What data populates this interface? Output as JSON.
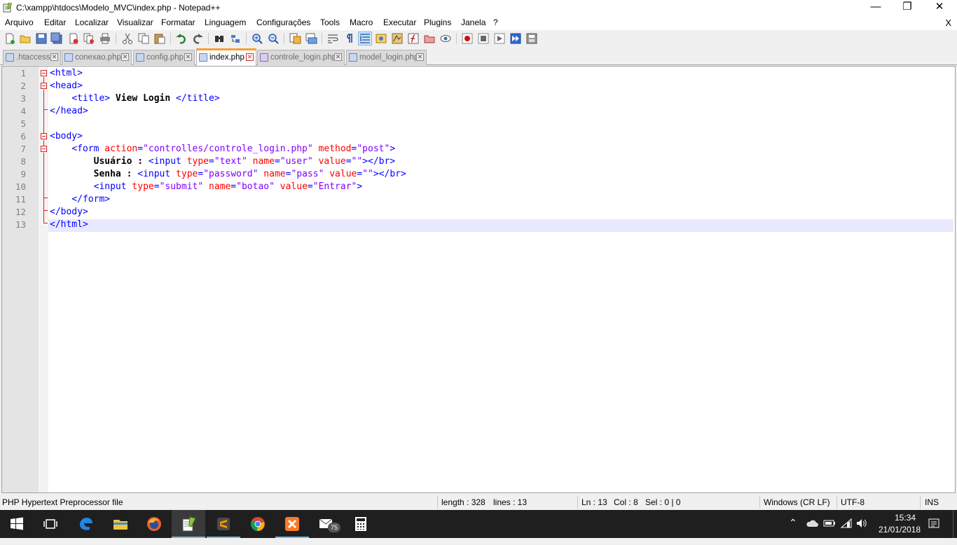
{
  "window": {
    "title": "C:\\xampp\\htdocs\\Modelo_MVC\\index.php - Notepad++",
    "minimize_glyph": "—",
    "restore_glyph": "❐",
    "close_glyph": "✕"
  },
  "menubar": {
    "items": [
      "Arquivo",
      "Editar",
      "Localizar",
      "Visualizar",
      "Formatar",
      "Linguagem",
      "Configurações",
      "Tools",
      "Macro",
      "Executar",
      "Plugins",
      "Janela",
      "?"
    ],
    "close_glyph": "X"
  },
  "toolbar": {
    "icons": [
      "new-file-icon",
      "open-file-icon",
      "save-icon",
      "save-all-icon",
      "close-file-icon",
      "close-all-icon",
      "print-icon",
      "cut-icon",
      "copy-icon",
      "paste-icon",
      "undo-icon",
      "redo-icon",
      "find-icon",
      "replace-icon",
      "zoom-in-icon",
      "zoom-out-icon",
      "sync-vertical-icon",
      "sync-horizontal-icon",
      "word-wrap-icon",
      "show-all-chars-icon",
      "indent-guide-icon",
      "user-defined-language-icon",
      "document-map-icon",
      "function-list-icon",
      "folder-workspace-icon",
      "monitoring-icon",
      "record-macro-icon",
      "stop-macro-icon",
      "play-macro-icon",
      "run-macro-multiple-icon",
      "save-macro-icon"
    ]
  },
  "tabs": [
    {
      "label": ".htaccess",
      "active": false,
      "icon": "file-icon"
    },
    {
      "label": "conexao.php",
      "active": false,
      "icon": "file-icon"
    },
    {
      "label": "config.php",
      "active": false,
      "icon": "file-icon"
    },
    {
      "label": "index.php",
      "active": true,
      "icon": "file-icon"
    },
    {
      "label": "controle_login.php",
      "active": false,
      "icon": "php-file-icon"
    },
    {
      "label": "model_login.php",
      "active": false,
      "icon": "file-icon"
    }
  ],
  "editor": {
    "line_numbers": [
      "1",
      "2",
      "3",
      "4",
      "5",
      "6",
      "7",
      "8",
      "9",
      "10",
      "11",
      "12",
      "13"
    ],
    "lines": [
      [
        {
          "c": "t",
          "s": "<html>"
        }
      ],
      [
        {
          "c": "t",
          "s": "<head>"
        }
      ],
      [
        {
          "c": "",
          "s": "    "
        },
        {
          "c": "t",
          "s": "<title>"
        },
        {
          "c": "x",
          "s": " View Login "
        },
        {
          "c": "t",
          "s": "</title>"
        }
      ],
      [
        {
          "c": "t",
          "s": "</head>"
        }
      ],
      [],
      [
        {
          "c": "t",
          "s": "<body>"
        }
      ],
      [
        {
          "c": "",
          "s": "    "
        },
        {
          "c": "t",
          "s": "<form "
        },
        {
          "c": "a",
          "s": "action"
        },
        {
          "c": "t",
          "s": "="
        },
        {
          "c": "v",
          "s": "\"controlles/controle_login.php\""
        },
        {
          "c": "t",
          "s": " "
        },
        {
          "c": "a",
          "s": "method"
        },
        {
          "c": "t",
          "s": "="
        },
        {
          "c": "v",
          "s": "\"post\""
        },
        {
          "c": "t",
          "s": ">"
        }
      ],
      [
        {
          "c": "",
          "s": "        "
        },
        {
          "c": "x",
          "s": "Usuário : "
        },
        {
          "c": "t",
          "s": "<input "
        },
        {
          "c": "a",
          "s": "type"
        },
        {
          "c": "t",
          "s": "="
        },
        {
          "c": "v",
          "s": "\"text\""
        },
        {
          "c": "t",
          "s": " "
        },
        {
          "c": "a",
          "s": "name"
        },
        {
          "c": "t",
          "s": "="
        },
        {
          "c": "v",
          "s": "\"user\""
        },
        {
          "c": "t",
          "s": " "
        },
        {
          "c": "a",
          "s": "value"
        },
        {
          "c": "t",
          "s": "="
        },
        {
          "c": "v",
          "s": "\"\""
        },
        {
          "c": "t",
          "s": "></br>"
        }
      ],
      [
        {
          "c": "",
          "s": "        "
        },
        {
          "c": "x",
          "s": "Senha : "
        },
        {
          "c": "t",
          "s": "<input "
        },
        {
          "c": "a",
          "s": "type"
        },
        {
          "c": "t",
          "s": "="
        },
        {
          "c": "v",
          "s": "\"password\""
        },
        {
          "c": "t",
          "s": " "
        },
        {
          "c": "a",
          "s": "name"
        },
        {
          "c": "t",
          "s": "="
        },
        {
          "c": "v",
          "s": "\"pass\""
        },
        {
          "c": "t",
          "s": " "
        },
        {
          "c": "a",
          "s": "value"
        },
        {
          "c": "t",
          "s": "="
        },
        {
          "c": "v",
          "s": "\"\""
        },
        {
          "c": "t",
          "s": "></br>"
        }
      ],
      [
        {
          "c": "",
          "s": "        "
        },
        {
          "c": "t",
          "s": "<input "
        },
        {
          "c": "a",
          "s": "type"
        },
        {
          "c": "t",
          "s": "="
        },
        {
          "c": "v",
          "s": "\"submit\""
        },
        {
          "c": "t",
          "s": " "
        },
        {
          "c": "a",
          "s": "name"
        },
        {
          "c": "t",
          "s": "="
        },
        {
          "c": "v",
          "s": "\"botao\""
        },
        {
          "c": "t",
          "s": " "
        },
        {
          "c": "a",
          "s": "value"
        },
        {
          "c": "t",
          "s": "="
        },
        {
          "c": "v",
          "s": "\"Entrar\""
        },
        {
          "c": "t",
          "s": ">"
        }
      ],
      [
        {
          "c": "",
          "s": "    "
        },
        {
          "c": "t",
          "s": "</form>"
        }
      ],
      [
        {
          "c": "t",
          "s": "</body>"
        }
      ],
      [
        {
          "c": "t",
          "s": "</html>"
        }
      ]
    ],
    "current_line": 13,
    "colors": {
      "tag": "#0000ff",
      "attribute": "#ff0000",
      "value": "#8000ff",
      "text": "#000000",
      "current_line_bg": "#e8e8ff",
      "active_tab_accent": "#fa9e32"
    }
  },
  "statusbar": {
    "file_type": "PHP Hypertext Preprocessor file",
    "length": "length : 328",
    "lines": "lines : 13",
    "ln": "Ln : 13",
    "col": "Col : 8",
    "sel": "Sel : 0 | 0",
    "eol": "Windows (CR LF)",
    "encoding": "UTF-8",
    "mode": "INS"
  },
  "taskbar": {
    "apps": [
      "windows-start-icon",
      "task-view-icon",
      "edge-icon",
      "file-explorer-icon",
      "firefox-icon",
      "notepadpp-icon",
      "sublime-text-icon",
      "chrome-icon",
      "xampp-icon",
      "mail-icon",
      "calculator-icon"
    ],
    "mail_badge": "75",
    "time": "15:34",
    "date": "21/01/2018"
  }
}
